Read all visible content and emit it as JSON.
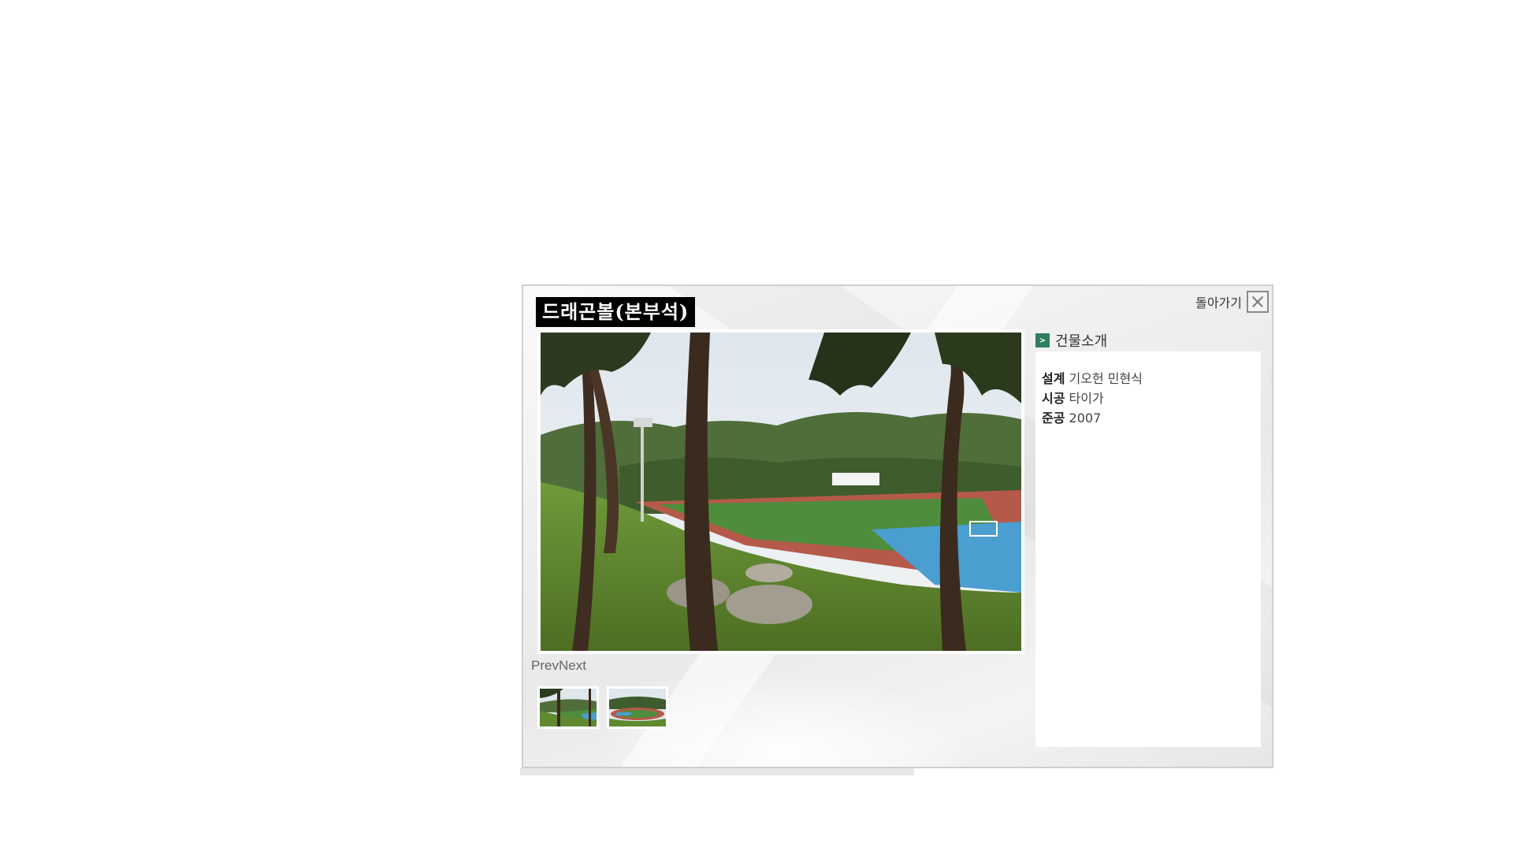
{
  "dialog": {
    "title": "드래곤볼(본부석)",
    "back_label": "돌아가기",
    "prev_label": "Prev",
    "next_label": "Next"
  },
  "gallery": {
    "thumbnails": [
      {
        "name": "thumbnail-1"
      },
      {
        "name": "thumbnail-2"
      }
    ]
  },
  "info": {
    "heading": "건물소개",
    "icon": "arrow-right-icon",
    "rows": [
      {
        "label": "설계",
        "value": "기오헌 민현식"
      },
      {
        "label": "시공",
        "value": "타이가"
      },
      {
        "label": "준공",
        "value": "2007"
      }
    ]
  },
  "colors": {
    "title_bg": "#000000",
    "info_icon": "#2f7f5e"
  }
}
